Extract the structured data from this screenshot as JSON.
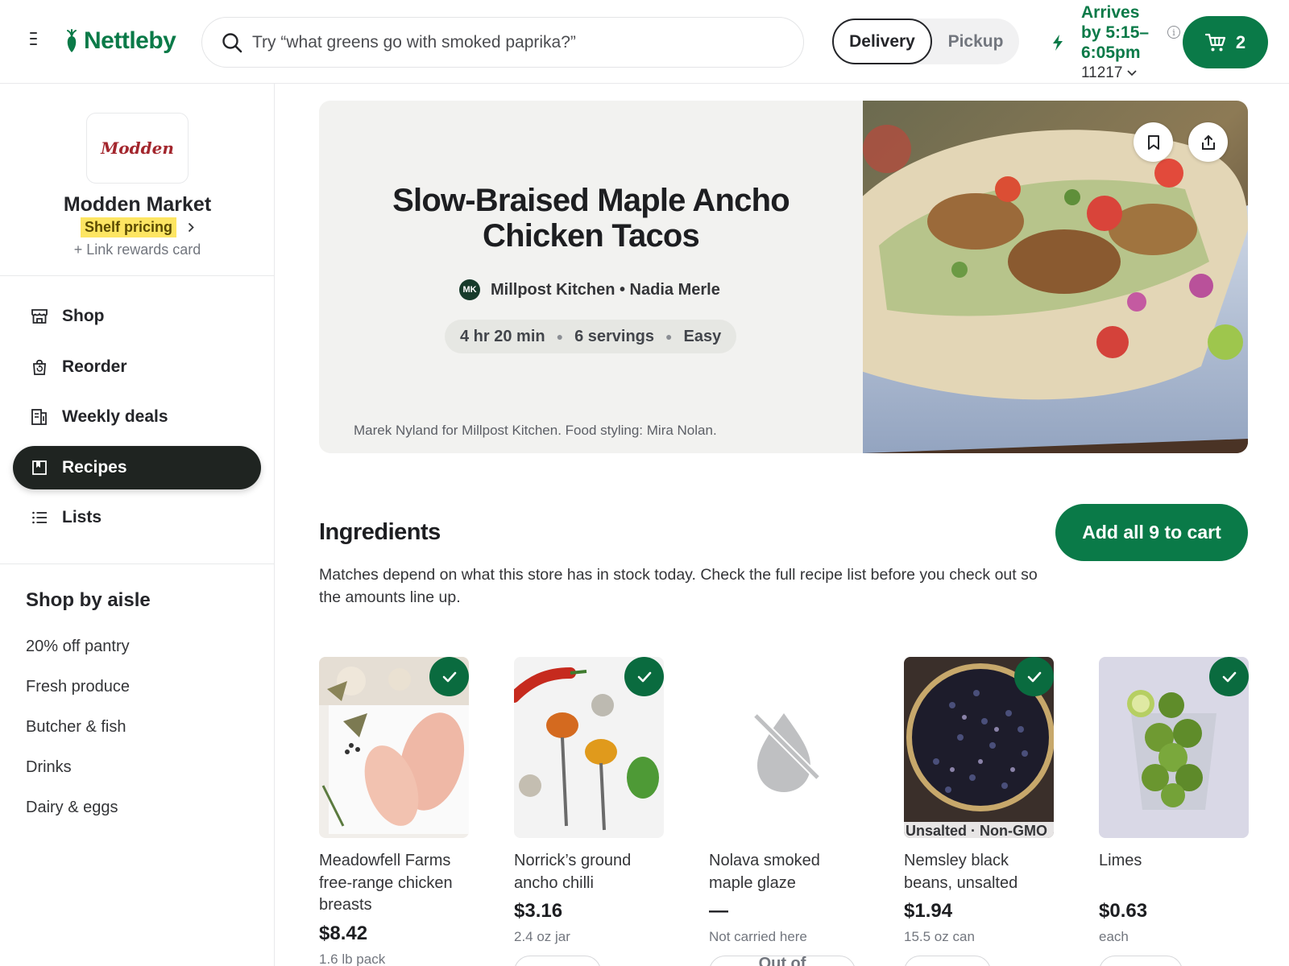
{
  "header": {
    "brand": "Nettleby",
    "search_placeholder": "Try “what greens go with smoked paprika?”",
    "mode_delivery": "Delivery",
    "mode_pickup": "Pickup",
    "eta": "Arrives by 5:15–6:05pm",
    "zip": "11217",
    "cart_count": "2",
    "accent_color": "#0a7a48"
  },
  "store": {
    "logo_text": "Modden",
    "name": "Modden Market",
    "pricing_badge": "Shelf pricing",
    "rewards_link": "+ Link rewards card"
  },
  "nav": [
    {
      "label": "Shop",
      "icon": "storefront-icon"
    },
    {
      "label": "Reorder",
      "icon": "bag-icon"
    },
    {
      "label": "Weekly deals",
      "icon": "deals-icon"
    },
    {
      "label": "Recipes",
      "icon": "bookmark-book-icon",
      "active": true
    },
    {
      "label": "Lists",
      "icon": "list-icon"
    }
  ],
  "aisles": {
    "title": "Shop by aisle",
    "items": [
      "20% off pantry",
      "Fresh produce",
      "Butcher & fish",
      "Drinks",
      "Dairy & eggs"
    ]
  },
  "recipe": {
    "title": "Slow-Braised Maple Ancho Chicken Tacos",
    "author_initials": "MK",
    "author": "Millpost Kitchen • Nadia Merle",
    "time": "4 hr 20 min",
    "servings": "6 servings",
    "difficulty": "Easy",
    "photo_credit": "Marek Nyland for Millpost Kitchen. Food styling: Mira Nolan."
  },
  "ingredients": {
    "title": "Ingredients",
    "add_all_label": "Add all 9 to cart",
    "description": "Matches depend on what this store has in stock today. Check the full recipe list before you check out so the amounts line up.",
    "items": [
      {
        "name": "Meadowfell Farms free-range chicken breasts",
        "price": "$8.42",
        "unit": "1.6 lb pack",
        "matched": true
      },
      {
        "name": "Norrick’s ground ancho chilli",
        "price": "$3.16",
        "unit": "2.4 oz jar",
        "matched": true
      },
      {
        "name": "Nolava smoked maple glaze",
        "price": "—",
        "unit": "Not carried here",
        "matched": false,
        "button": "Out of"
      },
      {
        "name": "Nemsley black beans, unsalted",
        "price": "$1.94",
        "unit": "15.5 oz can",
        "matched": true,
        "tag": "Unsalted · Non-GMO"
      },
      {
        "name": "Limes",
        "price": "$0.63",
        "unit": "each",
        "matched": true
      }
    ]
  }
}
